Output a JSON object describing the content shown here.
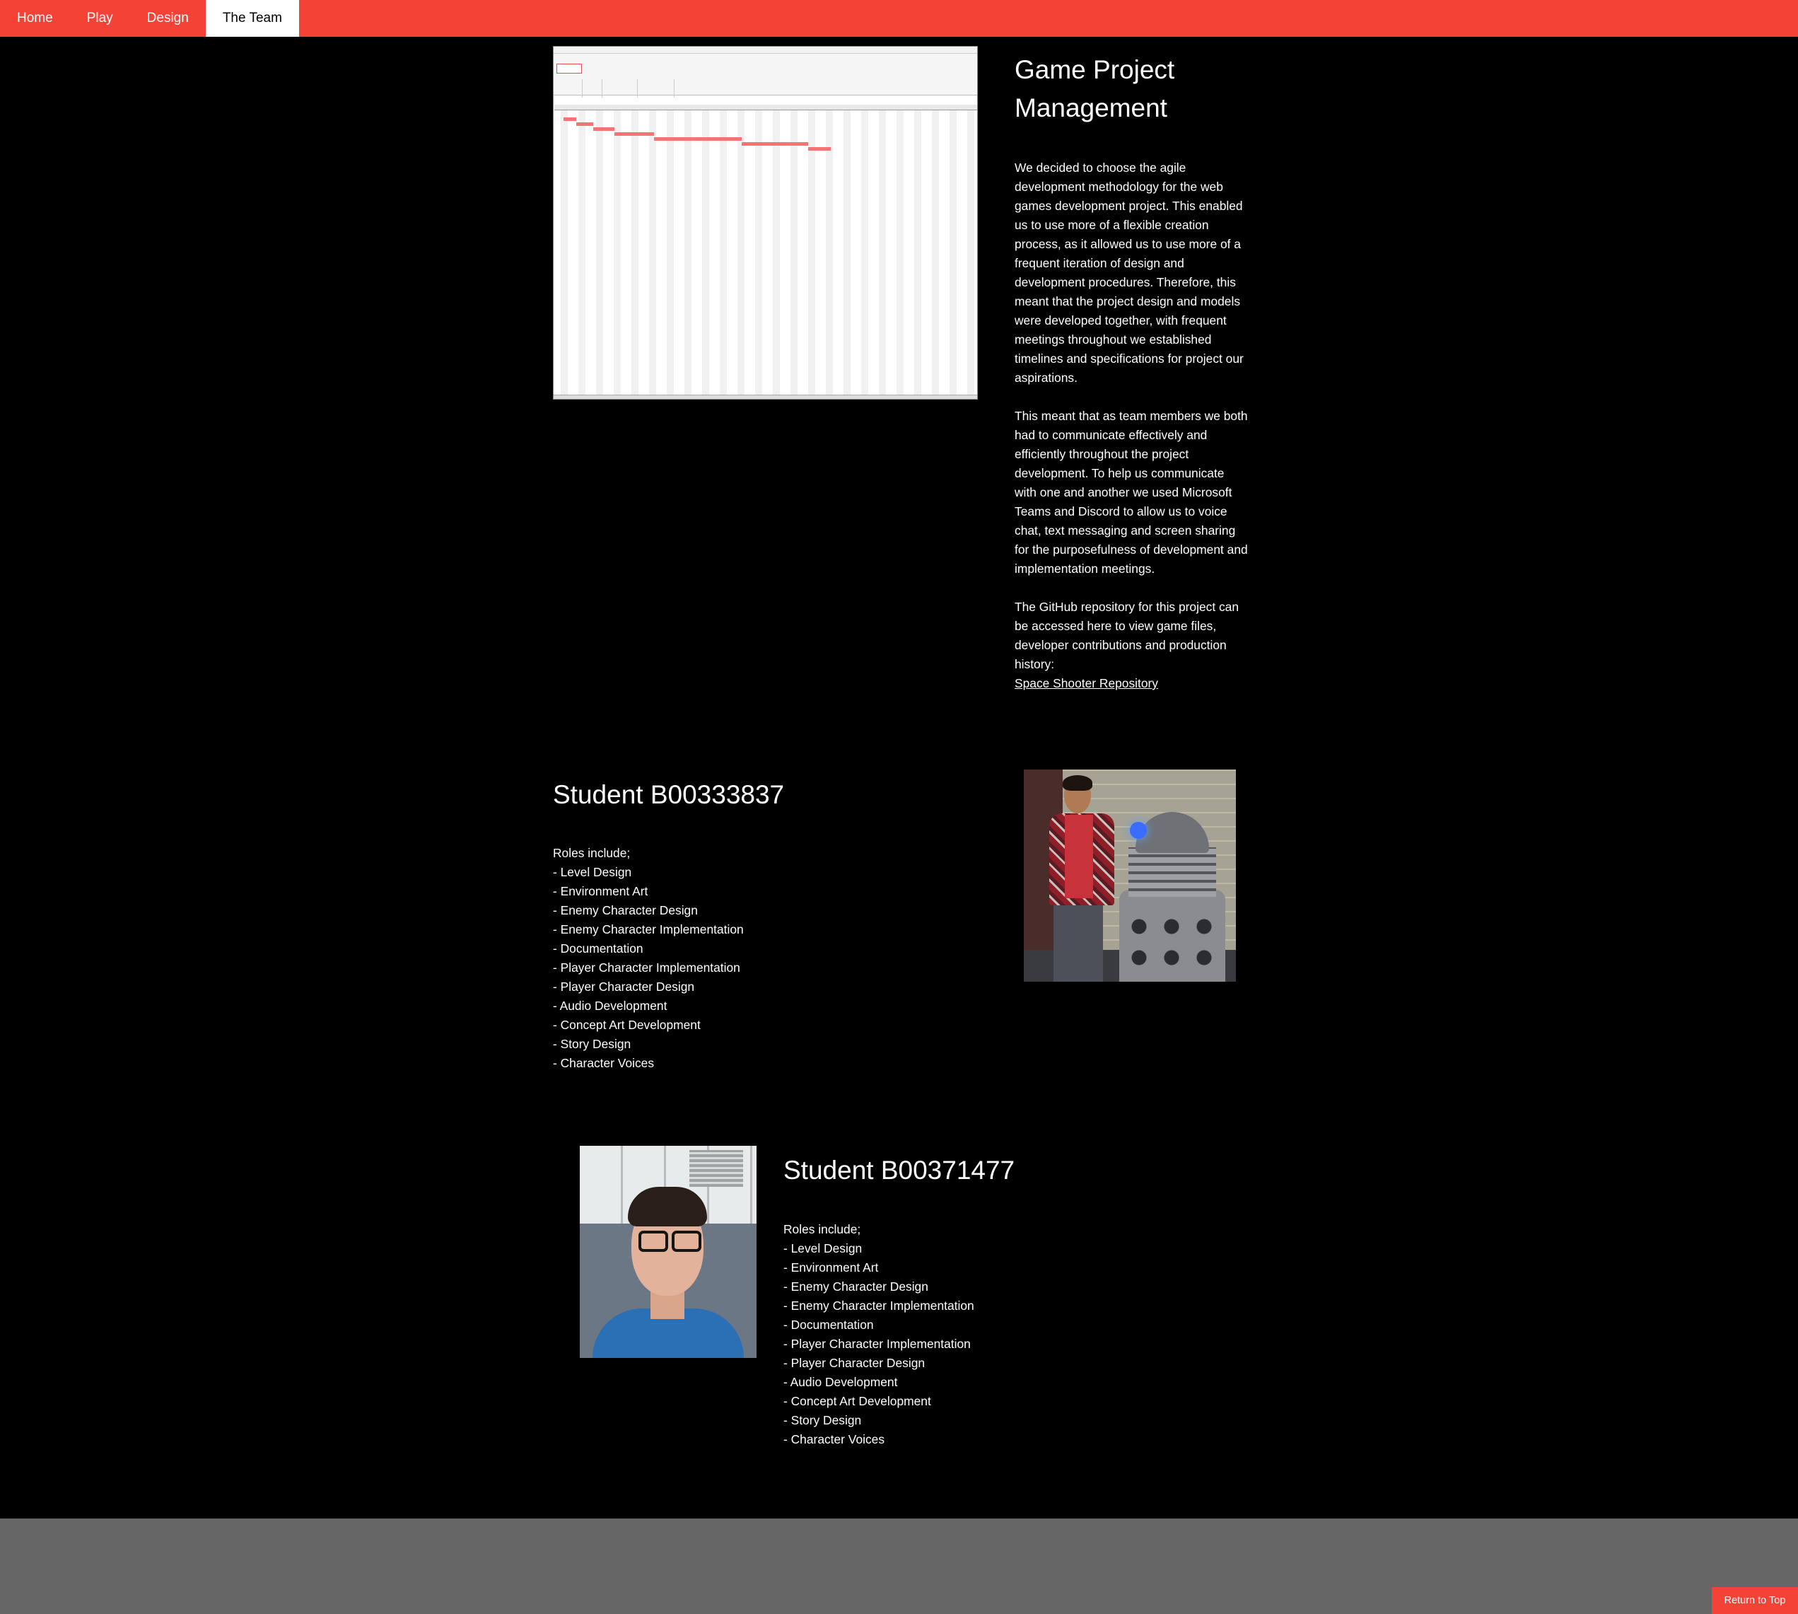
{
  "nav": {
    "items": [
      {
        "label": "Home"
      },
      {
        "label": "Play"
      },
      {
        "label": "Design"
      },
      {
        "label": "The Team",
        "active": true
      }
    ]
  },
  "project": {
    "title": "Game Project Management",
    "paragraph_1": "We decided to choose the agile development methodology for the web games development project. This enabled us to use more of a flexible creation process, as it allowed us to use more of a frequent iteration of design and development procedures. Therefore, this meant that the project design and models were developed together, with frequent meetings throughout we established timelines and specifications for project our aspirations.",
    "paragraph_2": "This meant that as team members we both had to communicate effectively and efficiently throughout the project development. To help us communicate with one and another we used Microsoft Teams and Discord to allow us to voice chat, text messaging and screen sharing for the purposefulness of development and implementation meetings.",
    "paragraph_3": "The GitHub repository for this project can be accessed here to view game files, developer contributions and production history:",
    "repo_link": "Space Shooter Repository"
  },
  "students": [
    {
      "title": "Student B00333837",
      "roles_intro": "Roles include;",
      "roles": [
        "- Level Design",
        "- Environment Art",
        "- Enemy Character Design",
        "- Enemy Character Implementation",
        "- Documentation",
        "- Player Character Implementation",
        "- Player Character Design",
        "- Audio Development",
        "- Concept Art Development",
        "- Story Design",
        "- Character Voices"
      ]
    },
    {
      "title": "Student B00371477",
      "roles_intro": "Roles include;",
      "roles": [
        "- Level Design",
        "- Environment Art",
        "- Enemy Character Design",
        "- Enemy Character Implementation",
        "- Documentation",
        "- Player Character Implementation",
        "- Player Character Design",
        "- Audio Development",
        "- Concept Art Development",
        "- Story Design",
        "- Character Voices"
      ]
    }
  ],
  "footer": {
    "return_to_top": "Return to Top"
  },
  "colors": {
    "accent": "#f44336",
    "background": "#000000",
    "footer": "#666666"
  }
}
